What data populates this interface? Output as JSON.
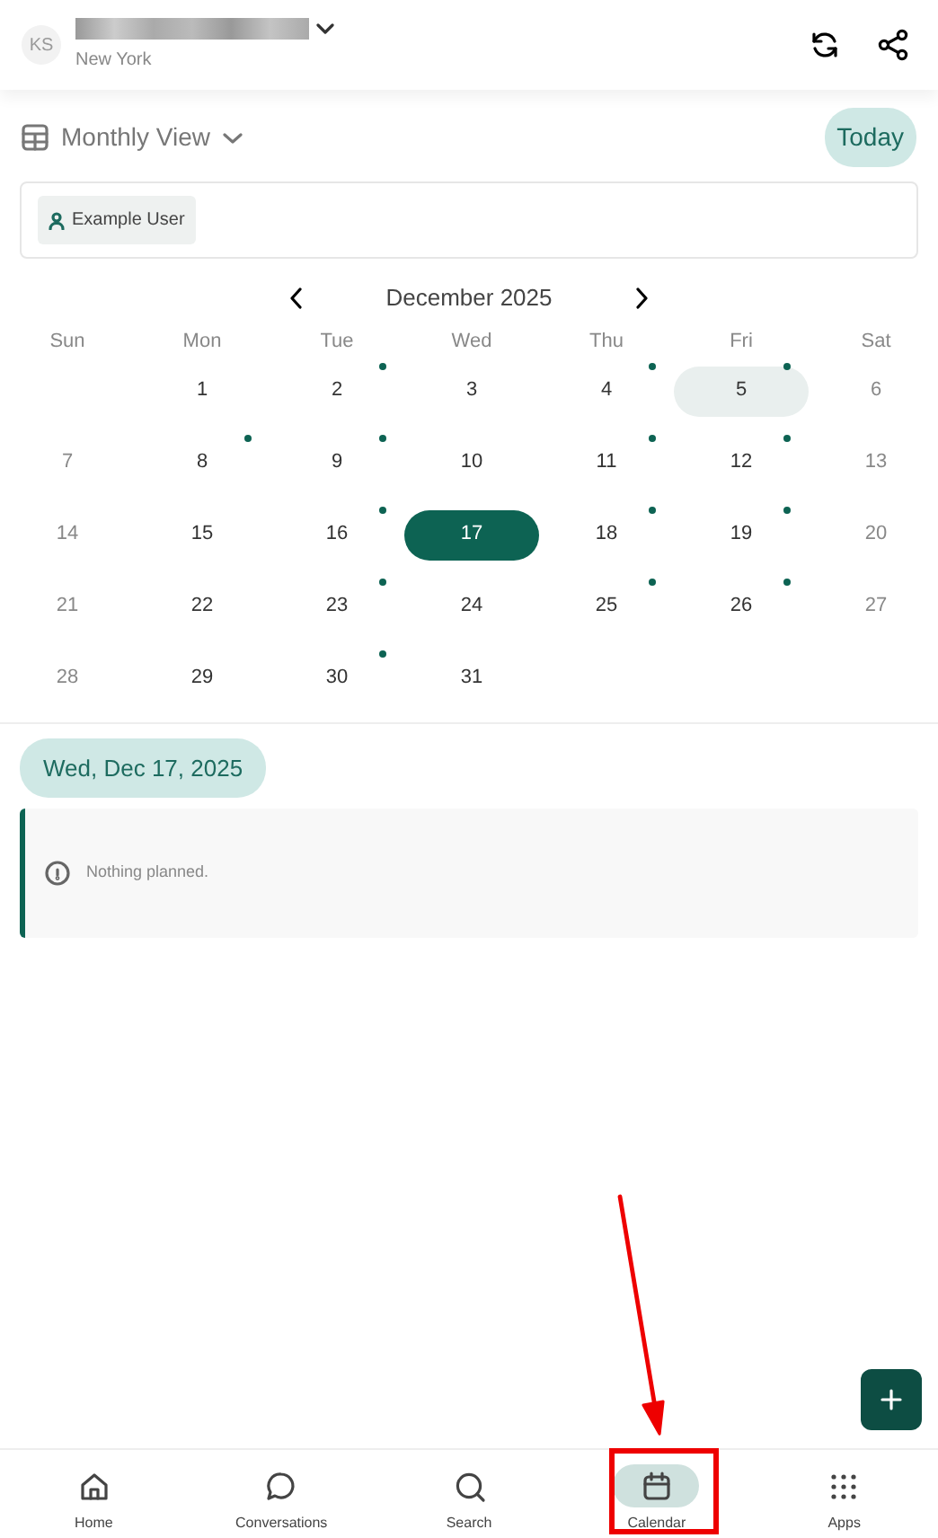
{
  "header": {
    "avatar": "KS",
    "location": "New York",
    "name_redacted": true
  },
  "toolbar": {
    "view": "Monthly View",
    "today_button": "Today"
  },
  "filters": [
    {
      "label": "Example User"
    }
  ],
  "calendar": {
    "month": "December 2025",
    "weekdays": [
      "Sun",
      "Mon",
      "Tue",
      "Wed",
      "Thu",
      "Fri",
      "Sat"
    ],
    "weeks": [
      [
        {
          "day": "1",
          "event": false,
          "selected": false,
          "today": false
        },
        {
          "day": "2",
          "event": true,
          "selected": false,
          "today": false
        },
        {
          "day": "3",
          "event": false,
          "selected": false,
          "today": false
        },
        {
          "day": "4",
          "event": true,
          "selected": false,
          "today": false
        },
        {
          "day": "5",
          "event": true,
          "selected": false,
          "today": true
        },
        {
          "day": "6",
          "event": false,
          "selected": false,
          "today": false
        }
      ],
      [
        {
          "day": "7",
          "event": false,
          "selected": false,
          "today": false
        },
        {
          "day": "8",
          "event": true,
          "selected": false,
          "today": false
        },
        {
          "day": "9",
          "event": true,
          "selected": false,
          "today": false
        },
        {
          "day": "10",
          "event": false,
          "selected": false,
          "today": false
        },
        {
          "day": "11",
          "event": true,
          "selected": false,
          "today": false
        },
        {
          "day": "12",
          "event": true,
          "selected": false,
          "today": false
        },
        {
          "day": "13",
          "event": false,
          "selected": false,
          "today": false
        }
      ],
      [
        {
          "day": "14",
          "event": false,
          "selected": false,
          "today": false
        },
        {
          "day": "15",
          "event": false,
          "selected": false,
          "today": false
        },
        {
          "day": "16",
          "event": true,
          "selected": false,
          "today": false
        },
        {
          "day": "17",
          "event": false,
          "selected": true,
          "today": false
        },
        {
          "day": "18",
          "event": true,
          "selected": false,
          "today": false
        },
        {
          "day": "19",
          "event": true,
          "selected": false,
          "today": false
        },
        {
          "day": "20",
          "event": false,
          "selected": false,
          "today": false
        }
      ],
      [
        {
          "day": "21",
          "event": false,
          "selected": false,
          "today": false
        },
        {
          "day": "22",
          "event": false,
          "selected": false,
          "today": false
        },
        {
          "day": "23",
          "event": true,
          "selected": false,
          "today": false
        },
        {
          "day": "24",
          "event": false,
          "selected": false,
          "today": false
        },
        {
          "day": "25",
          "event": true,
          "selected": false,
          "today": false
        },
        {
          "day": "26",
          "event": true,
          "selected": false,
          "today": false
        },
        {
          "day": "27",
          "event": false,
          "selected": false,
          "today": false
        }
      ],
      [
        {
          "day": "28",
          "event": false,
          "selected": false,
          "today": false
        },
        {
          "day": "29",
          "event": false,
          "selected": false,
          "today": false
        },
        {
          "day": "30",
          "event": true,
          "selected": false,
          "today": false
        },
        {
          "day": "31",
          "event": false,
          "selected": false,
          "today": false
        }
      ]
    ]
  },
  "agenda": {
    "date": "Wed, Dec 17, 2025",
    "empty_message": "Nothing planned."
  },
  "bottom_nav": [
    {
      "label": "Home",
      "selected": false,
      "highlighted": false
    },
    {
      "label": "Conversations",
      "selected": false,
      "highlighted": false
    },
    {
      "label": "Search",
      "selected": false,
      "highlighted": false
    },
    {
      "label": "Calendar",
      "selected": true,
      "highlighted": true
    },
    {
      "label": "Apps",
      "selected": false,
      "highlighted": false
    }
  ]
}
